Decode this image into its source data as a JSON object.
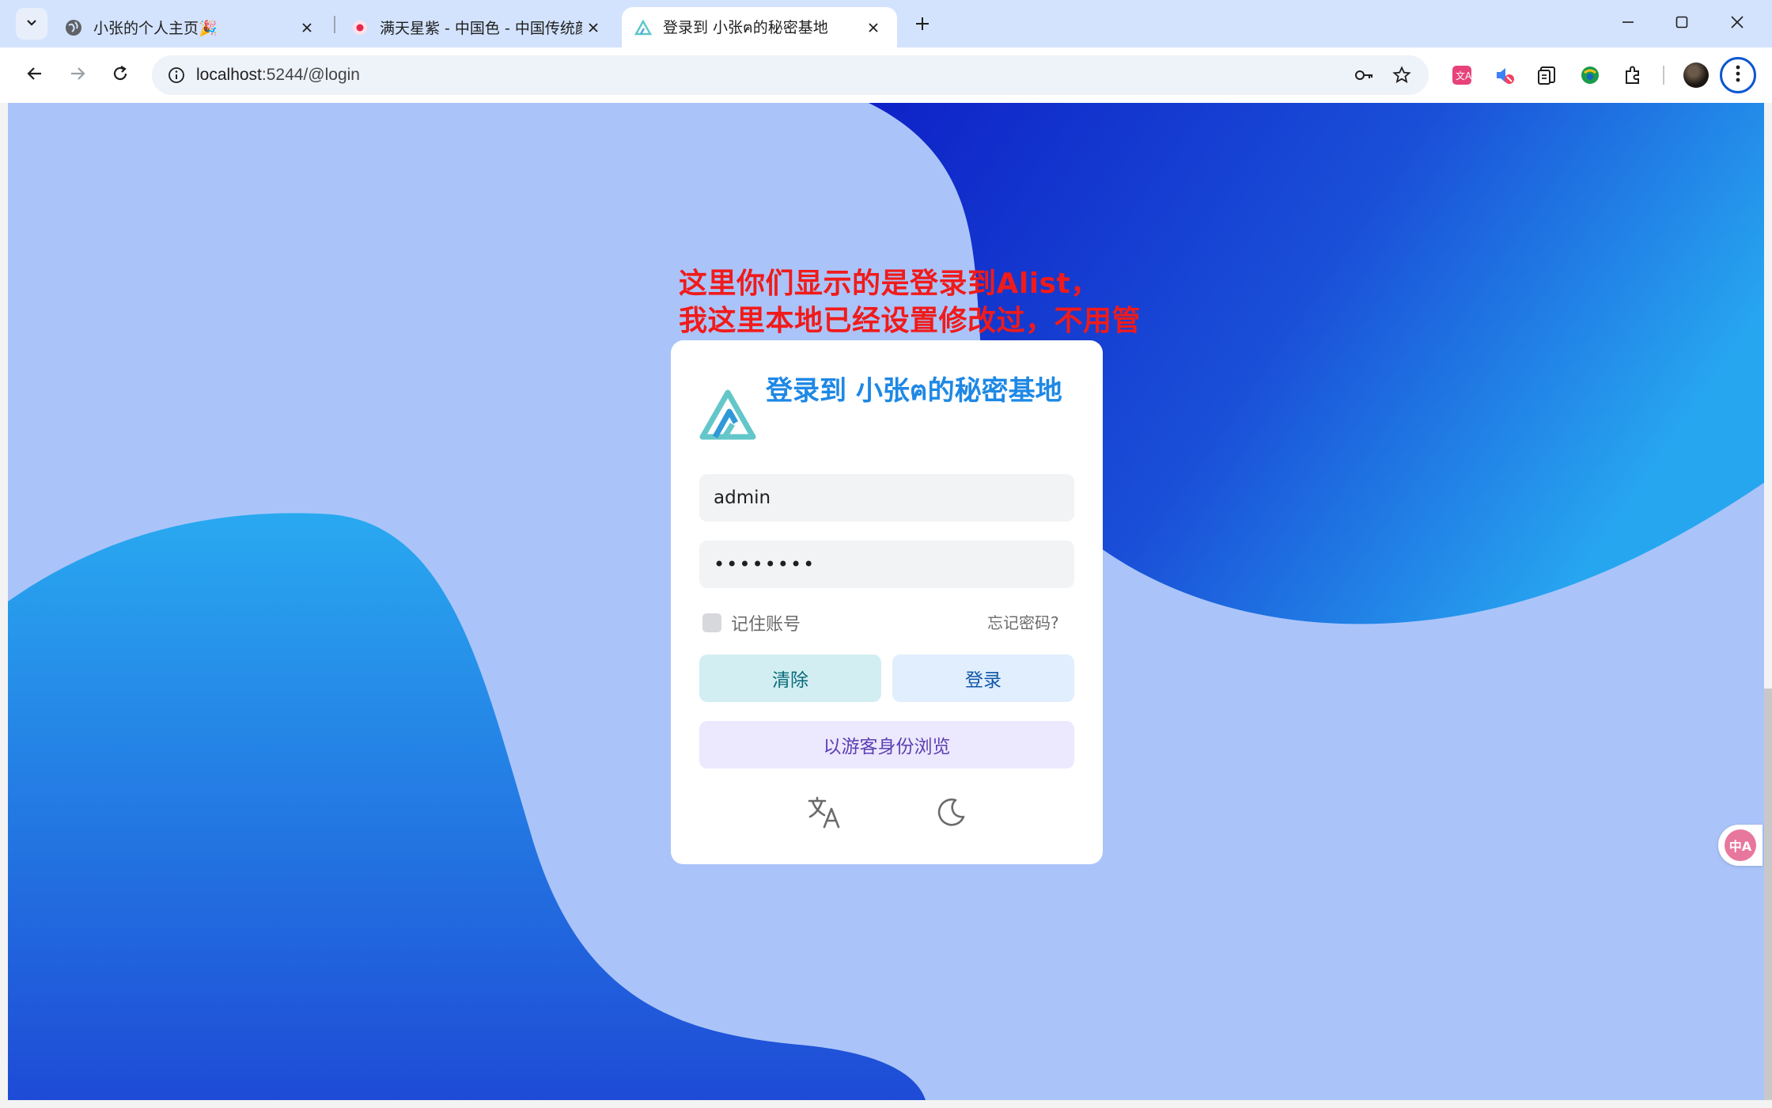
{
  "browser": {
    "tabs": [
      {
        "title": "小张的个人主页🎉",
        "active": false
      },
      {
        "title": "满天星紫 - 中国色 - 中国传统颜",
        "active": false
      },
      {
        "title": "登录到 小张ฅ的秘密基地",
        "active": true
      }
    ],
    "address": {
      "host": "localhost",
      "path": ":5244/@login"
    }
  },
  "annotation": {
    "line1": "这里你们显示的是登录到Alist，",
    "line2": "我这里本地已经设置修改过，不用管"
  },
  "login": {
    "title": "登录到 小张ฅ的秘密基地",
    "username_value": "admin",
    "password_value": "••••••••",
    "remember_label": "记住账号",
    "forgot_label": "忘记密码?",
    "clear_label": "清除",
    "login_label": "登录",
    "guest_label": "以游客身份浏览"
  },
  "float_translate": {
    "label": "中A"
  },
  "colors": {
    "background": "#aac4fa",
    "title_blue": "#1e88e5",
    "annotation_red": "#f01b1b",
    "blob_dark": "#1434cc",
    "blob_light": "#29a9f0"
  }
}
